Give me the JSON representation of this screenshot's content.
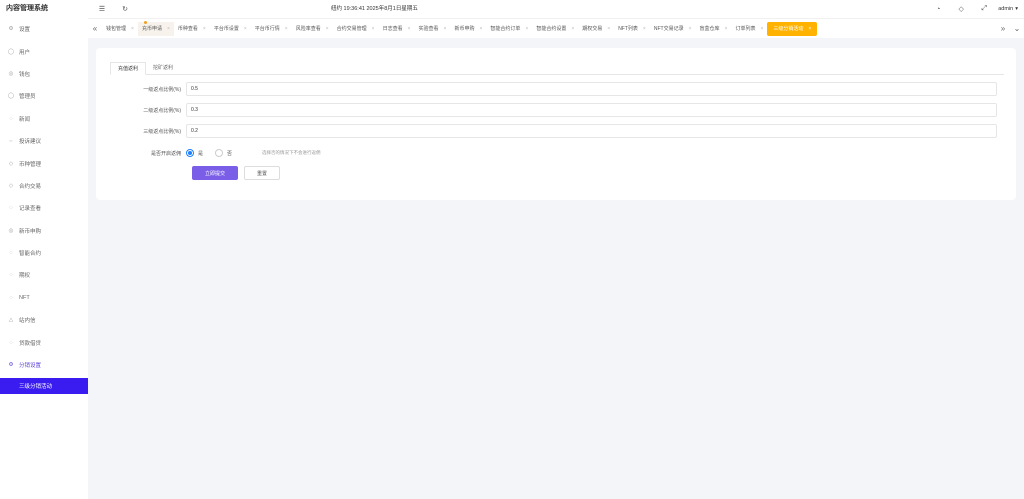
{
  "app": {
    "title": "内容管理系统"
  },
  "header": {
    "clock": "纽约 19:36:41 2025年8月1日星期五",
    "user": "admin",
    "icons": [
      "menu-fold-icon",
      "refresh-icon",
      "skin-icon",
      "tag-icon",
      "fullscreen-icon"
    ]
  },
  "sidebar": {
    "items": [
      {
        "label": "设置",
        "icon": "gear-icon"
      },
      {
        "label": "用户",
        "icon": "user-icon"
      },
      {
        "label": "钱包",
        "icon": "wallet-icon"
      },
      {
        "label": "管理员",
        "icon": "admin-icon"
      },
      {
        "label": "新闻",
        "icon": "news-icon"
      },
      {
        "label": "投诉建议",
        "icon": "feedback-icon"
      },
      {
        "label": "币种管理",
        "icon": "coin-icon"
      },
      {
        "label": "合约交易",
        "icon": "contract-icon"
      },
      {
        "label": "记录查看",
        "icon": "record-icon"
      },
      {
        "label": "新币申购",
        "icon": "newcoin-icon"
      },
      {
        "label": "智能合约",
        "icon": "smart-contract-icon"
      },
      {
        "label": "期权",
        "icon": "option-icon"
      },
      {
        "label": "NFT",
        "icon": "nft-icon"
      },
      {
        "label": "站内信",
        "icon": "bell-icon"
      },
      {
        "label": "贷款借贷",
        "icon": "loan-icon"
      },
      {
        "label": "分销设置",
        "icon": "distribution-icon"
      }
    ],
    "submenu": {
      "label": "三级分销活动"
    }
  },
  "tabs": {
    "items": [
      {
        "label": "钱包管理"
      },
      {
        "label": "充币申请"
      },
      {
        "label": "币种查看"
      },
      {
        "label": "平台币设置"
      },
      {
        "label": "平台币行情"
      },
      {
        "label": "风险率查看"
      },
      {
        "label": "合约交易管理"
      },
      {
        "label": "日志查看"
      },
      {
        "label": "实验查看"
      },
      {
        "label": "新币申购"
      },
      {
        "label": "智能合约订单"
      },
      {
        "label": "智能合约设置"
      },
      {
        "label": "期权交易"
      },
      {
        "label": "NFT列表"
      },
      {
        "label": "NFT交易记录"
      },
      {
        "label": "盲盒仓库"
      },
      {
        "label": "订单列表"
      },
      {
        "label": "三级分销活动"
      }
    ]
  },
  "form": {
    "tabs": [
      "充值返利",
      "挖矿返利"
    ],
    "fields": [
      {
        "label": "一级返点比例(%)",
        "value": "0.5"
      },
      {
        "label": "二级返点比例(%)",
        "value": "0.3"
      },
      {
        "label": "三级返点比例(%)",
        "value": "0.2"
      }
    ],
    "switch": {
      "label": "是否开启返佣",
      "yes": "是",
      "no": "否",
      "selected": "是",
      "hint": "选择否的情况下不会进行返佣"
    },
    "submit_label": "立即提交",
    "reset_label": "重置"
  },
  "colors": {
    "accent": "#3a1cf0",
    "active_tab": "#ffb300",
    "primary_button": "#7b5ee8",
    "radio": "#1e80ff"
  }
}
